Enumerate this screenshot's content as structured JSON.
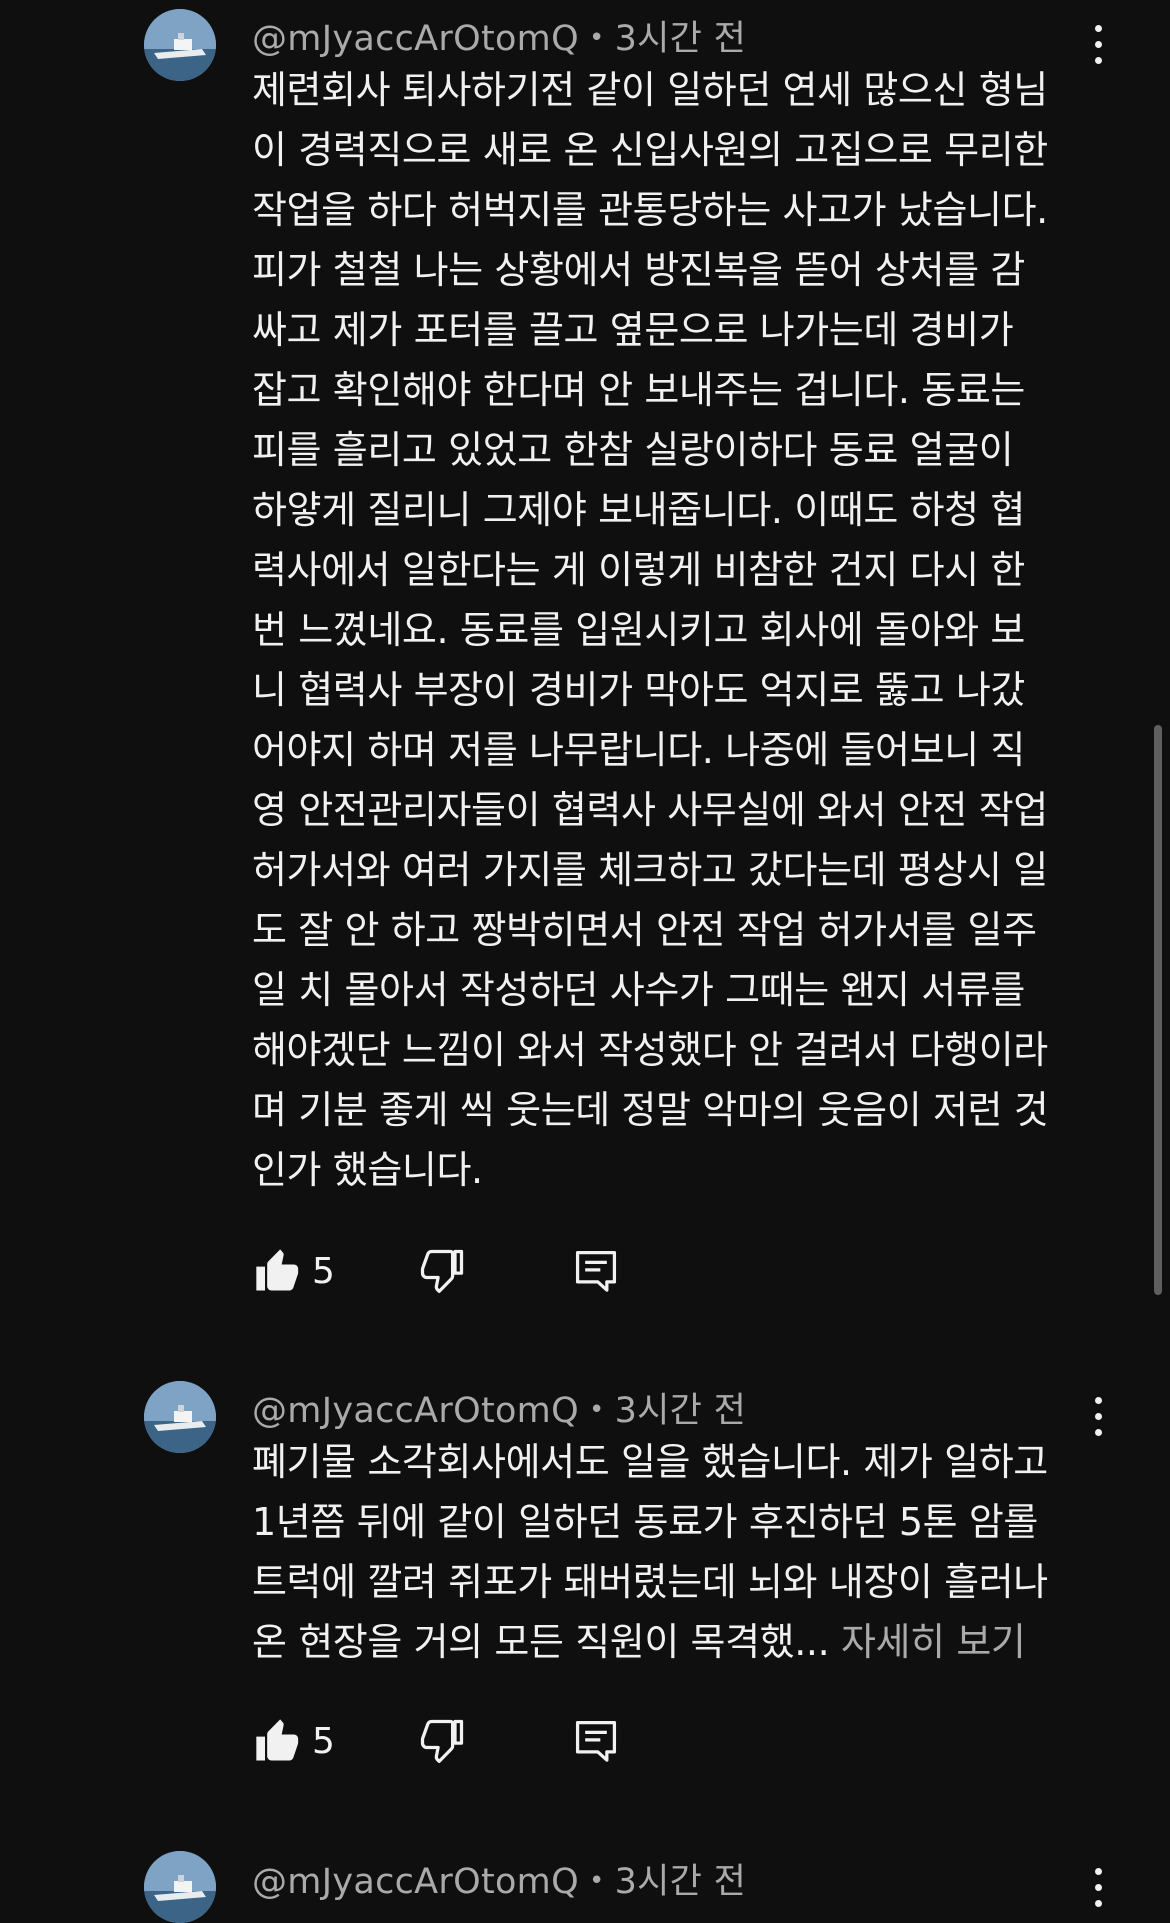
{
  "comments": [
    {
      "handle": "@mJyaccArOtomQ",
      "separator": "•",
      "time": "3시간 전",
      "lines": [
        "제련회사 퇴사하기전 같이 일하던 연세 많으신 형님",
        "이 경력직으로 새로 온 신입사원의 고집으로 무리한",
        "작업을 하다 허벅지를 관통당하는 사고가 났습니다.",
        "피가 철철 나는 상황에서 방진복을 뜯어 상처를 감",
        "싸고 제가 포터를 끌고 옆문으로 나가는데 경비가",
        "잡고 확인해야 한다며 안 보내주는 겁니다. 동료는",
        "피를 흘리고 있었고 한참 실랑이하다 동료 얼굴이",
        "하얗게 질리니 그제야 보내줍니다. 이때도 하청 협",
        "력사에서 일한다는 게 이렇게 비참한 건지 다시 한",
        "번 느꼈네요. 동료를 입원시키고 회사에 돌아와 보",
        "니 협력사 부장이 경비가 막아도 억지로 뚫고 나갔",
        "어야지 하며 저를 나무랍니다. 나중에 들어보니 직",
        "영 안전관리자들이 협력사 사무실에 와서 안전 작업",
        "허가서와 여러 가지를 체크하고 갔다는데 평상시 일",
        "도 잘 안 하고 짱박히면서 안전 작업 허가서를 일주",
        "일 치 몰아서 작성하던 사수가 그때는 왠지 서류를",
        "해야겠단 느낌이 와서 작성했다 안 걸려서 다행이라",
        "며 기분 좋게 씩 웃는데 정말 악마의 웃음이 저런 것",
        "인가 했습니다."
      ],
      "read_more": "",
      "like_count": "5"
    },
    {
      "handle": "@mJyaccArOtomQ",
      "separator": "•",
      "time": "3시간 전",
      "lines": [
        "폐기물 소각회사에서도 일을 했습니다. 제가 일하고",
        "1년쯤 뒤에 같이 일하던 동료가 후진하던 5톤 암롤",
        "트럭에 깔려 쥐포가 돼버렸는데 뇌와 내장이 흘러나",
        "온 현장을 거의 모든 직원이 목격했..."
      ],
      "read_more": "자세히 보기",
      "like_count": "5"
    },
    {
      "handle": "@mJyaccArOtomQ",
      "separator": "•",
      "time": "3시간 전"
    }
  ],
  "icons": {
    "like": "thumbs-up-filled-icon",
    "dislike": "thumbs-down-outline-icon",
    "reply": "comment-reply-icon",
    "more": "vertical-ellipsis-icon"
  },
  "colors": {
    "background": "#0f0f0f",
    "text": "#f1f1f1",
    "secondary_text": "#aaaaaa",
    "scrollbar": "#5f5f5f"
  }
}
